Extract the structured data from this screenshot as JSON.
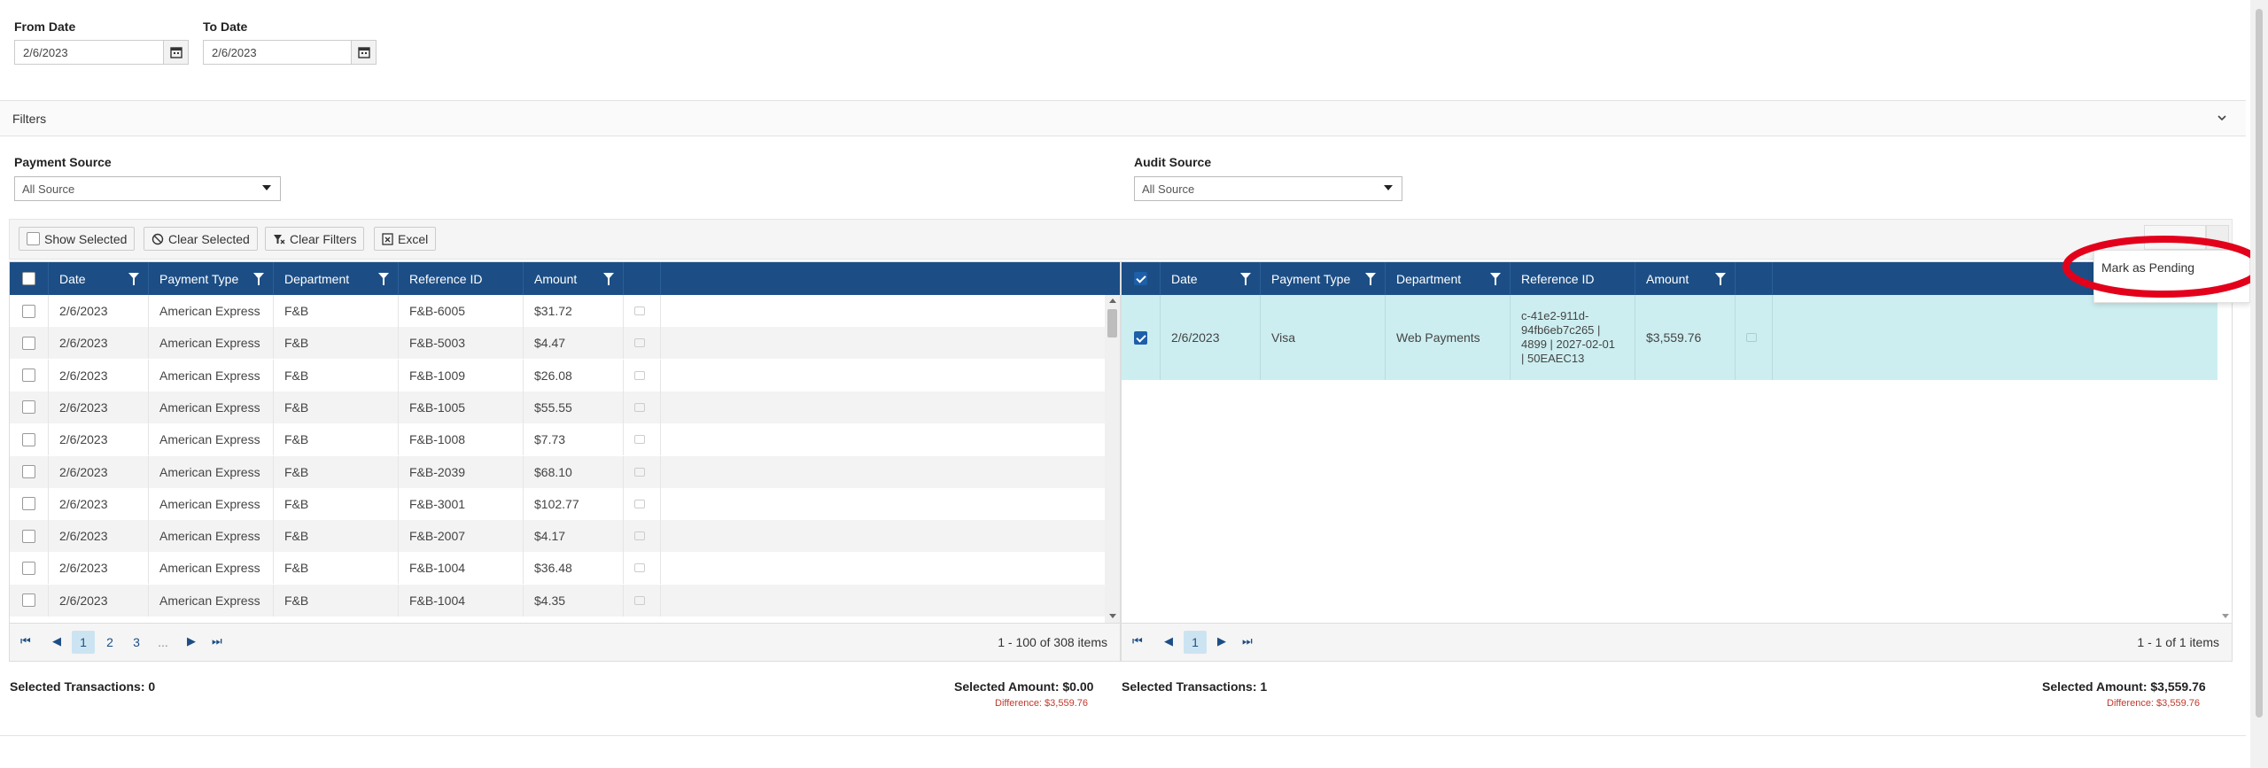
{
  "dates": {
    "from_label": "From Date",
    "from_value": "2/6/2023",
    "to_label": "To Date",
    "to_value": "2/6/2023"
  },
  "filters": {
    "title": "Filters",
    "payment_source_label": "Payment Source",
    "payment_source_value": "All Source",
    "audit_source_label": "Audit Source",
    "audit_source_value": "All Source"
  },
  "toolbar": {
    "show_selected": "Show Selected",
    "clear_selected": "Clear Selected",
    "clear_filters": "Clear Filters",
    "excel": "Excel"
  },
  "left_grid": {
    "columns": [
      "Date",
      "Payment Type",
      "Department",
      "Reference ID",
      "Amount"
    ],
    "rows": [
      {
        "date": "2/6/2023",
        "type": "American Express",
        "dept": "F&B",
        "ref": "F&B-6005",
        "amount": "$31.72"
      },
      {
        "date": "2/6/2023",
        "type": "American Express",
        "dept": "F&B",
        "ref": "F&B-5003",
        "amount": "$4.47"
      },
      {
        "date": "2/6/2023",
        "type": "American Express",
        "dept": "F&B",
        "ref": "F&B-1009",
        "amount": "$26.08"
      },
      {
        "date": "2/6/2023",
        "type": "American Express",
        "dept": "F&B",
        "ref": "F&B-1005",
        "amount": "$55.55"
      },
      {
        "date": "2/6/2023",
        "type": "American Express",
        "dept": "F&B",
        "ref": "F&B-1008",
        "amount": "$7.73"
      },
      {
        "date": "2/6/2023",
        "type": "American Express",
        "dept": "F&B",
        "ref": "F&B-2039",
        "amount": "$68.10"
      },
      {
        "date": "2/6/2023",
        "type": "American Express",
        "dept": "F&B",
        "ref": "F&B-3001",
        "amount": "$102.77"
      },
      {
        "date": "2/6/2023",
        "type": "American Express",
        "dept": "F&B",
        "ref": "F&B-2007",
        "amount": "$4.17"
      },
      {
        "date": "2/6/2023",
        "type": "American Express",
        "dept": "F&B",
        "ref": "F&B-1004",
        "amount": "$36.48"
      },
      {
        "date": "2/6/2023",
        "type": "American Express",
        "dept": "F&B",
        "ref": "F&B-1004",
        "amount": "$4.35"
      }
    ],
    "pages": [
      "1",
      "2",
      "3",
      "..."
    ],
    "items_info": "1 - 100 of 308 items",
    "selected_transactions": "Selected Transactions: 0",
    "selected_amount": "Selected Amount: $0.00",
    "difference": "Difference: $3,559.76"
  },
  "right_grid": {
    "columns": [
      "Date",
      "Payment Type",
      "Department",
      "Reference ID",
      "Amount"
    ],
    "rows": [
      {
        "date": "2/6/2023",
        "type": "Visa",
        "dept": "Web Payments",
        "ref_lines": [
          "c-41e2-911d-",
          "94fb6eb7c265 |",
          "4899 | 2027-02-01",
          "| 50EAEC13"
        ],
        "amount": "$3,559.76"
      }
    ],
    "pages": [
      "1"
    ],
    "items_info": "1 - 1 of 1 items",
    "selected_transactions": "Selected Transactions: 1",
    "selected_amount": "Selected Amount: $3,559.76",
    "difference": "Difference: $3,559.76"
  },
  "context_menu": {
    "item": "Mark as Pending"
  },
  "colors": {
    "header": "#1c4e85",
    "selected_row": "#cdeef0",
    "highlight_ring": "#e3001b",
    "difference": "#c0392b"
  }
}
